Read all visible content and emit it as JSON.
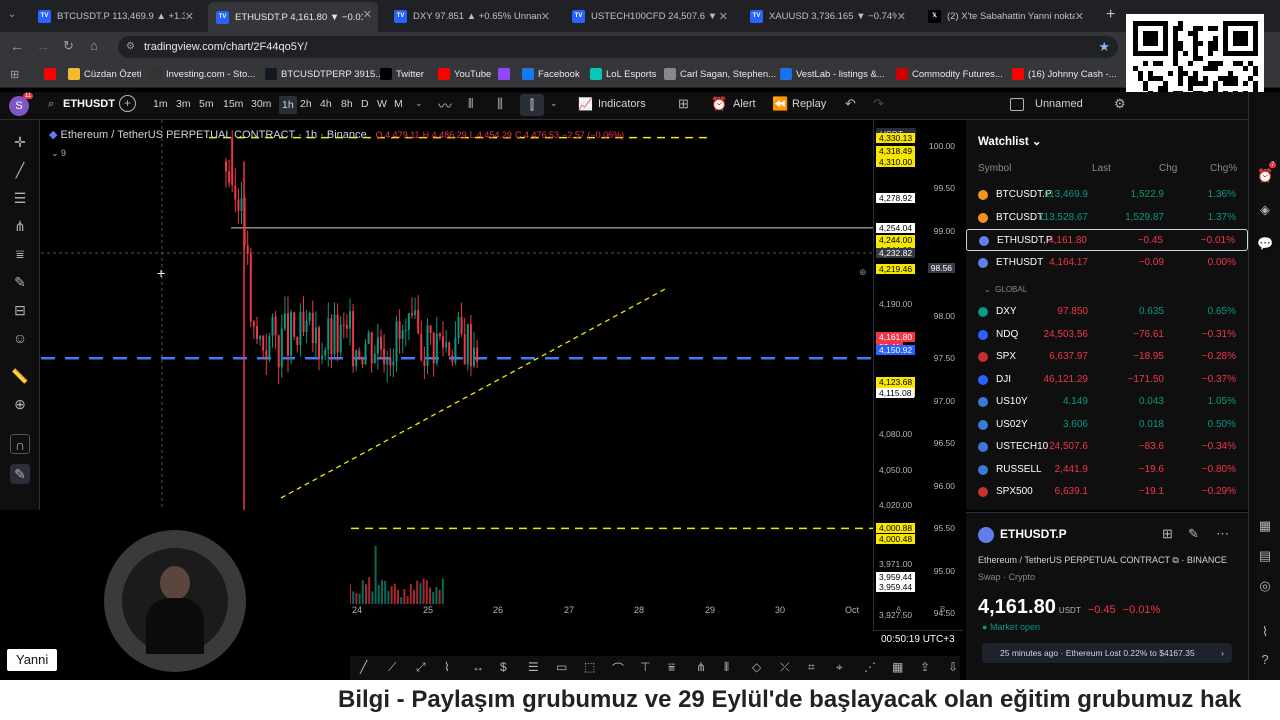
{
  "browser": {
    "tabs": [
      {
        "title": "BTCUSDT.P 113,469.9 ▲ +1.36%",
        "color": "#2962ff",
        "icon": "TV"
      },
      {
        "title": "ETHUSDT.P 4,161.80 ▼ −0.01%",
        "color": "#2962ff",
        "icon": "TV"
      },
      {
        "title": "DXY 97.851 ▲ +0.65% Unname",
        "color": "#2962ff",
        "icon": "TV"
      },
      {
        "title": "USTECH100CFD 24,507.6 ▼ −0.",
        "color": "#2962ff",
        "icon": "TV"
      },
      {
        "title": "XAUUSD 3,736.165 ▼ −0.74% U",
        "color": "#2962ff",
        "icon": "TV"
      },
      {
        "title": "(2) X'te Sabahattin Yanni nokta",
        "color": "#000000",
        "icon": "X"
      }
    ],
    "url": "tradingview.com/chart/2F44qo5Y/",
    "bookmarks": [
      {
        "label": "",
        "color": "#ff0000"
      },
      {
        "label": "Cüzdan Özeti",
        "color": "#f3ba2f"
      },
      {
        "label": "Investing.com - Sto...",
        "color": "#333333"
      },
      {
        "label": "BTCUSDTPERP 3915...",
        "color": "#131722"
      },
      {
        "label": "Twitter",
        "color": "#000000"
      },
      {
        "label": "YouTube",
        "color": "#ff0000"
      },
      {
        "label": "",
        "color": "#9146ff"
      },
      {
        "label": "Facebook",
        "color": "#1877f2"
      },
      {
        "label": "LoL Esports",
        "color": "#0ac8b9"
      },
      {
        "label": "Carl Sagan, Stephen...",
        "color": "#888888"
      },
      {
        "label": "VestLab - listings &...",
        "color": "#1a73e8"
      },
      {
        "label": "Commodity Futures...",
        "color": "#cc0000"
      },
      {
        "label": "(16) Johnny Cash -...",
        "color": "#ff0000"
      }
    ]
  },
  "toolbar": {
    "avatar_letter": "S",
    "avatar_badge": "11",
    "symbol": "ETHUSDT",
    "intervals": [
      "1m",
      "3m",
      "5m",
      "15m",
      "30m",
      "1h",
      "2h",
      "4h",
      "8h",
      "D",
      "W",
      "M"
    ],
    "active_interval": "1h",
    "indicators": "Indicators",
    "alert": "Alert",
    "replay": "Replay",
    "layout_name": "Unnamed"
  },
  "chart": {
    "legend_title": "Ethereum / TetherUS PERPETUAL CONTRACT · 1h · Binance",
    "ohlc": {
      "o": "O 4,479.11",
      "h": "H 4,486.29",
      "l": "L 4,454.29",
      "c": "C 4,476.53",
      "chg": "−2.57 (−0.06%)"
    },
    "legend_count": "9",
    "currency": "USDT",
    "price_labels": [
      {
        "text": "4,330.13",
        "y": 4330.13,
        "bg": "#f7e600",
        "fg": "#000"
      },
      {
        "text": "4,318.49",
        "y": 4318.49,
        "bg": "#f7e600",
        "fg": "#000"
      },
      {
        "text": "4,318.49",
        "y": 4318.49,
        "bg": "#f7e600",
        "fg": "#000",
        "row": 1
      },
      {
        "text": "4,310.00",
        "y": 4310.0,
        "bg": "#f7e600",
        "fg": "#000"
      },
      {
        "text": "4,278.92",
        "y": 4278.92,
        "bg": "#ffffff",
        "fg": "#000"
      },
      {
        "text": "4,254.04",
        "y": 4254.04,
        "bg": "#ffffff",
        "fg": "#000"
      },
      {
        "text": "4,244.00",
        "y": 4244.0,
        "bg": "#f7e600",
        "fg": "#000"
      },
      {
        "text": "4,244.00",
        "y": 4244.0,
        "bg": "#f7e600",
        "fg": "#000",
        "row": 1
      },
      {
        "text": "4,232.82",
        "y": 4232.82,
        "bg": "#363a45",
        "fg": "#fff"
      },
      {
        "text": "4,219.46",
        "y": 4219.46,
        "bg": "#f7e600",
        "fg": "#000"
      },
      {
        "text": "4,190.00",
        "y": 4190.0,
        "bg": "transparent",
        "fg": "#b2b5be"
      },
      {
        "text": "4,161.80",
        "y": 4161.8,
        "bg": "#f23645",
        "fg": "#fff"
      },
      {
        "text": "09:41",
        "y": 4161.8,
        "bg": "#f23645",
        "fg": "#fff",
        "row": 1
      },
      {
        "text": "4,150.92",
        "y": 4150.92,
        "bg": "#2962ff",
        "fg": "#fff"
      },
      {
        "text": "4,123.68",
        "y": 4123.68,
        "bg": "#f7e600",
        "fg": "#000"
      },
      {
        "text": "4,123.68",
        "y": 4123.68,
        "bg": "#f7e600",
        "fg": "#000",
        "row": 1
      },
      {
        "text": "4,115.08",
        "y": 4115.08,
        "bg": "#ffffff",
        "fg": "#000"
      },
      {
        "text": "4,080.00",
        "y": 4080.0,
        "bg": "transparent",
        "fg": "#b2b5be"
      },
      {
        "text": "4,050.00",
        "y": 4050.0,
        "bg": "transparent",
        "fg": "#b2b5be"
      },
      {
        "text": "4,020.00",
        "y": 4020.0,
        "bg": "transparent",
        "fg": "#b2b5be"
      },
      {
        "text": "4,000.88",
        "y": 4000.88,
        "bg": "#f7e600",
        "fg": "#000"
      },
      {
        "text": "4,000.48",
        "y": 4000.48,
        "bg": "#f7e600",
        "fg": "#000",
        "row": 1
      },
      {
        "text": "3,971.00",
        "y": 3971.0,
        "bg": "transparent",
        "fg": "#b2b5be"
      },
      {
        "text": "3,959.44",
        "y": 3959.44,
        "bg": "#ffffff",
        "fg": "#000"
      },
      {
        "text": "3,959.44",
        "y": 3959.44,
        "bg": "#ffffff",
        "fg": "#000",
        "row": 1
      },
      {
        "text": "3,927.50",
        "y": 3927.5,
        "bg": "transparent",
        "fg": "#b2b5be"
      }
    ],
    "dxy_axis": [
      "100.00",
      "99.50",
      "99.00",
      "98.56",
      "98.00",
      "97.50",
      "97.00",
      "96.50",
      "96.00",
      "95.50",
      "95.00",
      "94.50"
    ],
    "x_labels": [
      "24",
      "25",
      "26",
      "27",
      "28",
      "29",
      "30",
      "Oct"
    ],
    "time": "00:50:19 UTC+3",
    "axis_letters": [
      "A",
      "B"
    ]
  },
  "watchlist": {
    "title": "Watchlist",
    "columns": [
      "Symbol",
      "Last",
      "Chg",
      "Chg%"
    ],
    "rows": [
      {
        "symbol": "BTCUSDT.P",
        "last": "113,469.9",
        "chg": "1,522.9",
        "pct": "1.36%",
        "dir": "up",
        "icon": "#f7931a"
      },
      {
        "symbol": "BTCUSDT",
        "last": "113,528.67",
        "chg": "1,529.87",
        "pct": "1.37%",
        "dir": "up",
        "icon": "#f7931a"
      },
      {
        "symbol": "ETHUSDT.P",
        "last": "4,161.80",
        "chg": "−0.45",
        "pct": "−0.01%",
        "dir": "down",
        "icon": "#627eea"
      },
      {
        "symbol": "ETHUSDT",
        "last": "4,164.17",
        "chg": "−0.09",
        "pct": "0.00%",
        "dir": "down",
        "icon": "#627eea"
      }
    ],
    "section": "GLOBAL",
    "global_rows": [
      {
        "symbol": "DXY",
        "last": "97.850",
        "chg": "0.635",
        "pct": "0.65%",
        "dir": "up",
        "icon": "#089981",
        "lastcolor": "#f23645"
      },
      {
        "symbol": "NDQ",
        "last": "24,503.56",
        "chg": "−76.61",
        "pct": "−0.31%",
        "dir": "down",
        "icon": "#2962ff"
      },
      {
        "symbol": "SPX",
        "last": "6,637.97",
        "chg": "−18.95",
        "pct": "−0.28%",
        "dir": "down",
        "icon": "#c92f2f"
      },
      {
        "symbol": "DJI",
        "last": "46,121.29",
        "chg": "−171.50",
        "pct": "−0.37%",
        "dir": "down",
        "icon": "#2962ff"
      },
      {
        "symbol": "US10Y",
        "last": "4.149",
        "chg": "0.043",
        "pct": "1.05%",
        "dir": "up",
        "icon": "#3c78d8"
      },
      {
        "symbol": "US02Y",
        "last": "3.606",
        "chg": "0.018",
        "pct": "0.50%",
        "dir": "up",
        "icon": "#3c78d8"
      },
      {
        "symbol": "USTECH10",
        "last": "24,507.6",
        "chg": "−83.6",
        "pct": "−0.34%",
        "dir": "down",
        "icon": "#3c78d8"
      },
      {
        "symbol": "RUSSELL",
        "last": "2,441.9",
        "chg": "−19.6",
        "pct": "−0.80%",
        "dir": "down",
        "icon": "#3c78d8"
      },
      {
        "symbol": "SPX500",
        "last": "6,639.1",
        "chg": "−19.1",
        "pct": "−0.29%",
        "dir": "down",
        "icon": "#c92f2f"
      }
    ]
  },
  "detail": {
    "symbol": "ETHUSDT.P",
    "fullname": "Ethereum / TetherUS PERPETUAL CONTRACT",
    "exchange": "BINANCE",
    "type": "Swap · Crypto",
    "price_main": "4,161.",
    "price_small": "80",
    "currency": "USDT",
    "change": "−0.45",
    "change_pct": "−0.01%",
    "market": "Market open",
    "news_time": "25 minutes ago",
    "news": "Ethereum Lost 0.22% to $4167.35"
  },
  "webcam": {
    "name": "Yanni"
  },
  "ticker": "Bilgi - Paylaşım grubumuz ve 29 Eylül'de başlayacak olan eğitim grubumuz hak"
}
